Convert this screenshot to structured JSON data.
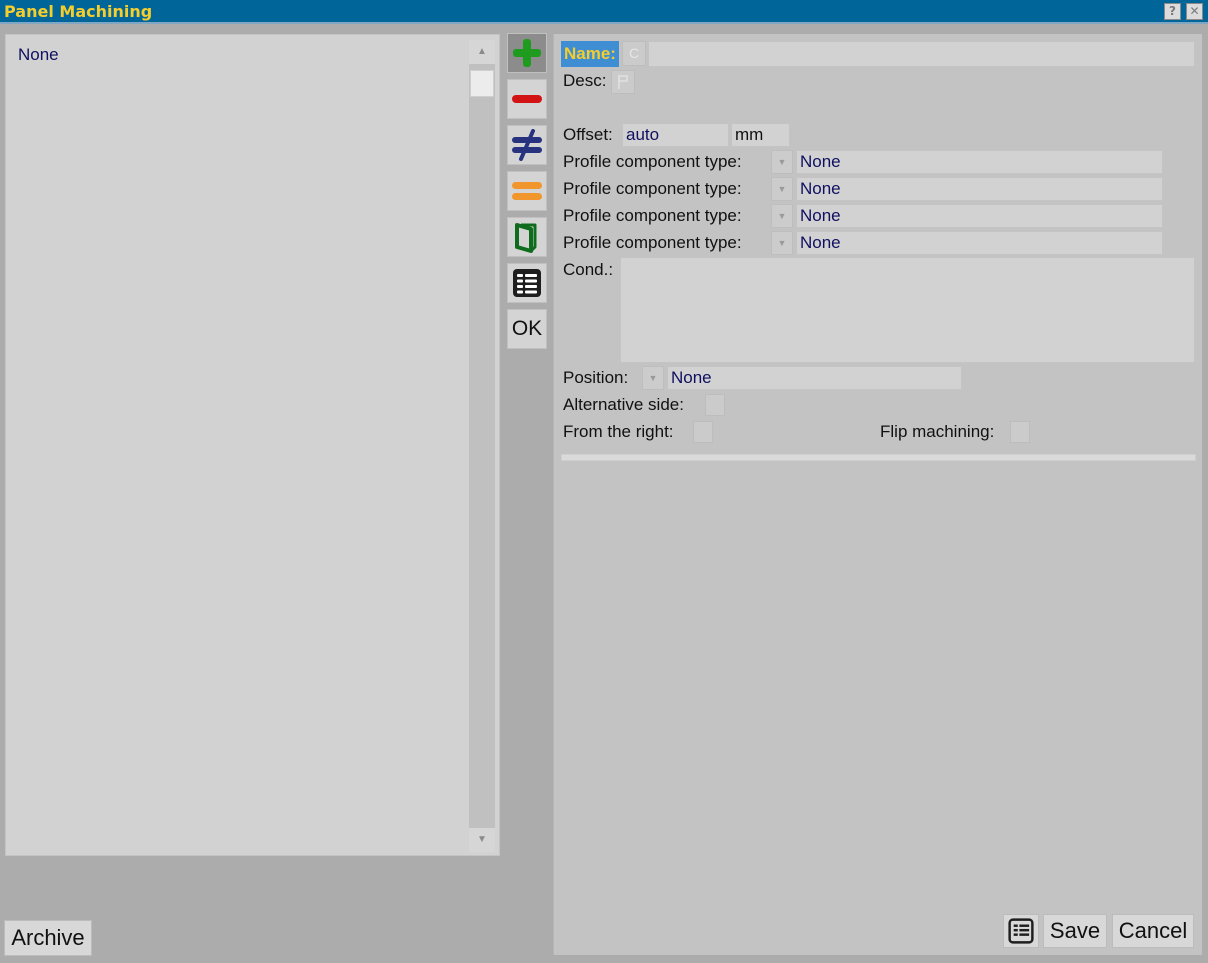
{
  "window": {
    "title": "Panel Machining",
    "help_label": "?",
    "close_label": "✕"
  },
  "list": {
    "items": [
      "None"
    ]
  },
  "toolbar": {
    "icons": [
      "add-icon",
      "remove-icon",
      "not-equal-icon",
      "equal-icon",
      "copy-icon",
      "list-icon"
    ],
    "ok_label": "OK"
  },
  "form": {
    "name_label": "Name:",
    "name_prefix": "C",
    "name_value": "",
    "desc_label": "Desc:",
    "offset_label": "Offset:",
    "offset_value": "auto",
    "offset_unit": "mm",
    "profile_components": [
      {
        "label": "Profile component type:",
        "value": "None"
      },
      {
        "label": "Profile component type:",
        "value": "None"
      },
      {
        "label": "Profile component type:",
        "value": "None"
      },
      {
        "label": "Profile component type:",
        "value": "None"
      }
    ],
    "cond_label": "Cond.:",
    "cond_value": "",
    "position_label": "Position:",
    "position_value": "None",
    "alternative_side_label": "Alternative side:",
    "from_right_label": "From the right:",
    "flip_machining_label": "Flip machining:"
  },
  "bottom": {
    "archive_label": "Archive",
    "save_label": "Save",
    "cancel_label": "Cancel"
  },
  "colors": {
    "titlebar": "#006699",
    "title_text": "#f5cd2c",
    "value_text": "#101060",
    "add": "#1f9c1f",
    "remove": "#d21414",
    "not_equal": "#27337f",
    "equal": "#f0962c",
    "copy": "#0f6b1e"
  }
}
